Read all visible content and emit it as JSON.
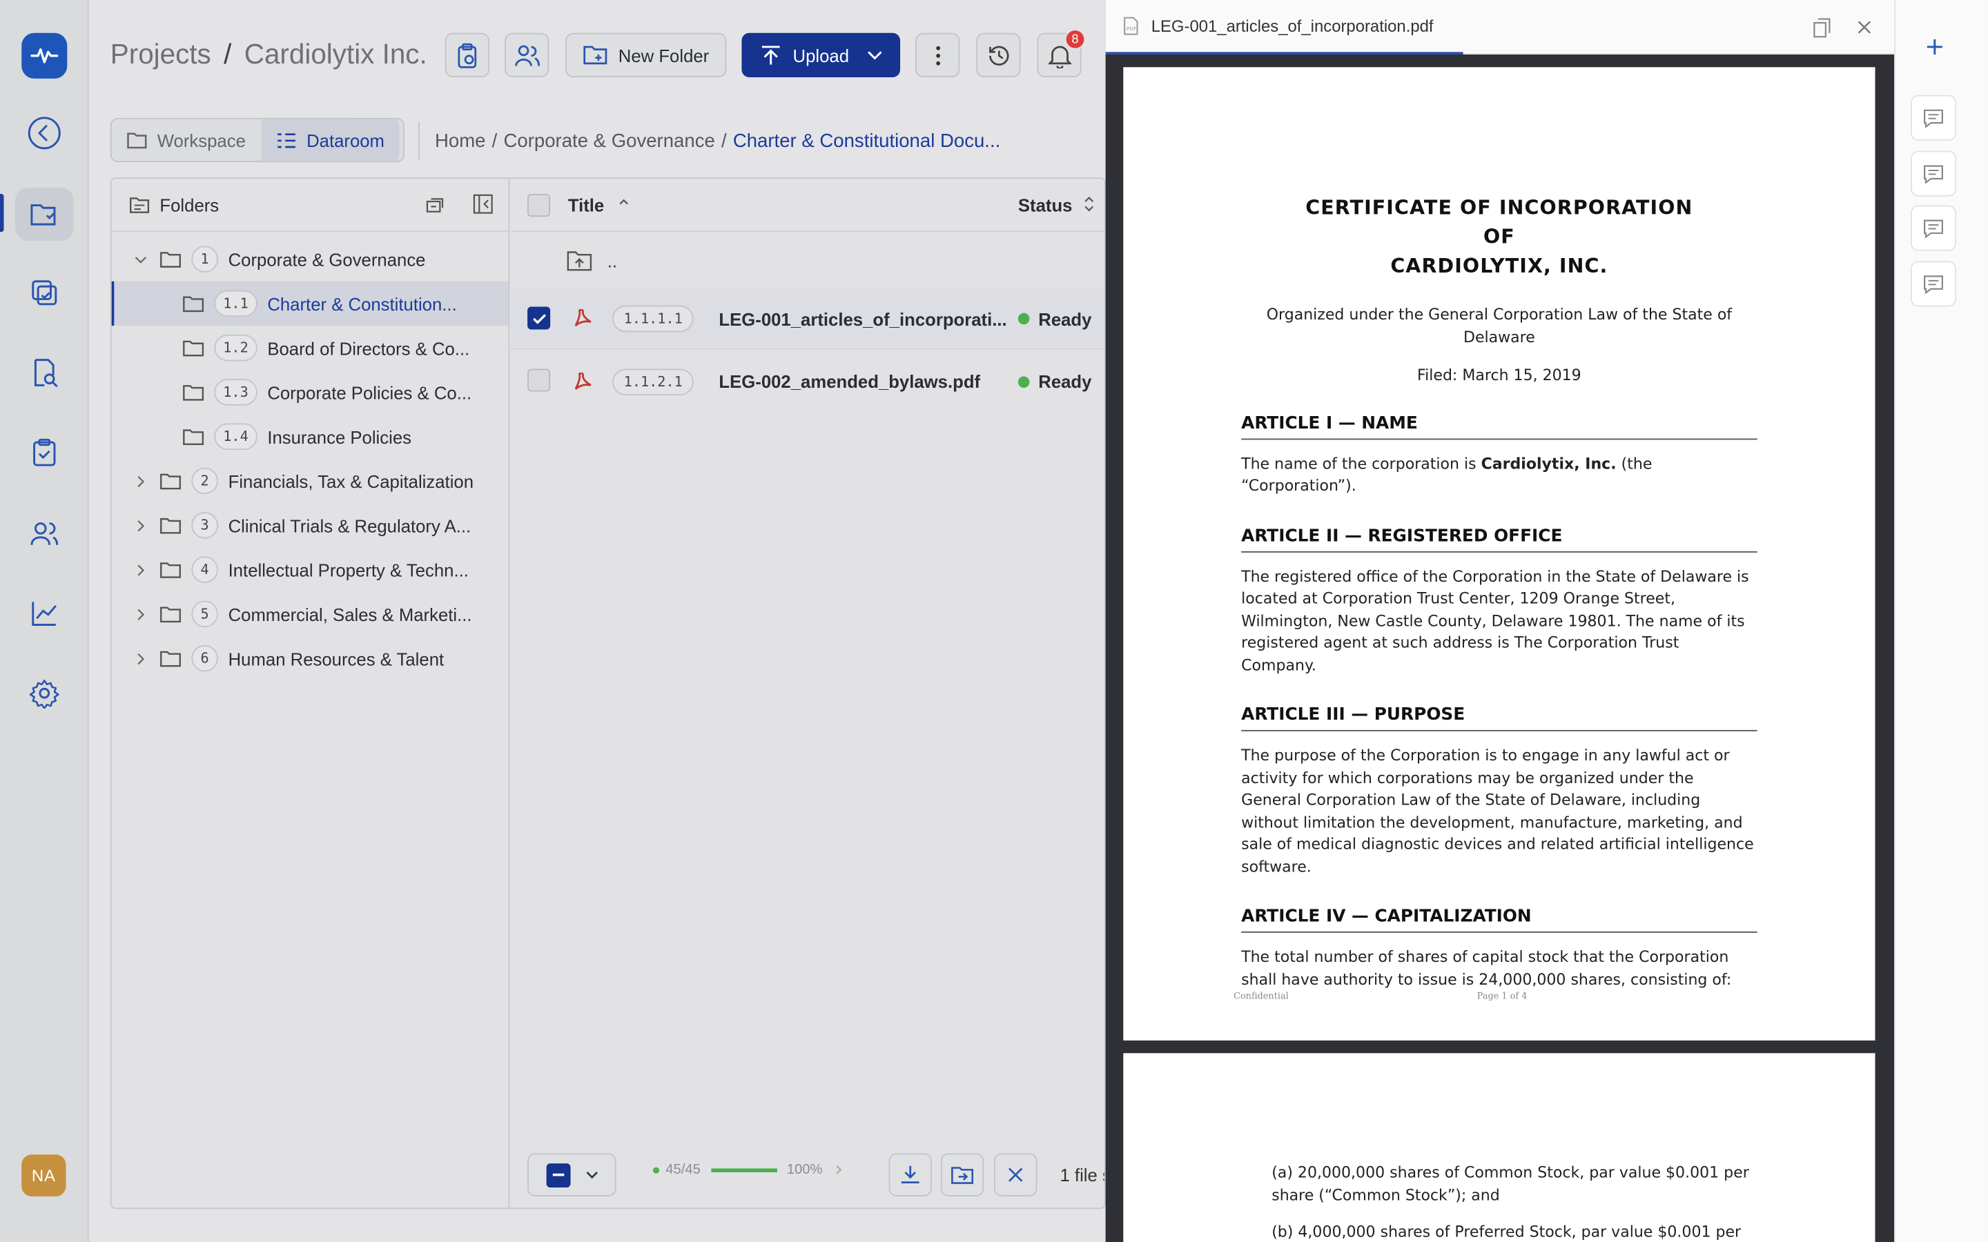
{
  "header": {
    "title": "Projects",
    "project": "Cardiolytix Inc.",
    "new_folder_label": "New Folder",
    "upload_label": "Upload",
    "notification_count": "8"
  },
  "view_toggle": {
    "workspace": "Workspace",
    "dataroom": "Dataroom"
  },
  "breadcrumb": [
    "Home",
    "Corporate & Governance",
    "Charter & Constitutional Docu..."
  ],
  "folders": {
    "title": "Folders",
    "items": [
      {
        "num": "1",
        "label": "Corporate & Governance"
      },
      {
        "num": "1.1",
        "label": "Charter & Constitution..."
      },
      {
        "num": "1.2",
        "label": "Board of Directors & Co..."
      },
      {
        "num": "1.3",
        "label": "Corporate Policies & Co..."
      },
      {
        "num": "1.4",
        "label": "Insurance Policies"
      },
      {
        "num": "2",
        "label": "Financials, Tax & Capitalization"
      },
      {
        "num": "3",
        "label": "Clinical Trials & Regulatory A..."
      },
      {
        "num": "4",
        "label": "Intellectual Property & Techn..."
      },
      {
        "num": "5",
        "label": "Commercial, Sales & Marketi..."
      },
      {
        "num": "6",
        "label": "Human Resources & Talent"
      }
    ]
  },
  "documents": {
    "col_title": "Title",
    "col_status": "Status",
    "parent_label": "..",
    "rows": [
      {
        "code": "1.1.1.1",
        "name": "LEG-001_articles_of_incorporati...",
        "status": "Ready"
      },
      {
        "code": "1.1.2.1",
        "name": "LEG-002_amended_bylaws.pdf",
        "status": "Ready"
      }
    ]
  },
  "footer": {
    "count": "45/45",
    "percent": "100%",
    "progress_fraction": 1.0,
    "selection_text": "1 file s"
  },
  "user": {
    "initials": "NA"
  },
  "viewer": {
    "filename": "LEG-001_articles_of_incorporation.pdf",
    "doc": {
      "title_lines": [
        "CERTIFICATE OF INCORPORATION",
        "OF",
        "CARDIOLYTIX, INC."
      ],
      "organized": "Organized under the General Corporation Law of the State of Delaware",
      "filed": "Filed: March 15, 2019",
      "a1_title": "ARTICLE I — NAME",
      "a1_pre": "The name of the corporation is ",
      "a1_bold": "Cardiolytix, Inc.",
      "a1_post": " (the “Corporation”).",
      "a2_title": "ARTICLE II — REGISTERED OFFICE",
      "a2_text": "The registered office of the Corporation in the State of Delaware is located at Corporation Trust Center, 1209 Orange Street, Wilmington, New Castle County, Delaware 19801. The name of its registered agent at such address is The Corporation Trust Company.",
      "a3_title": "ARTICLE III — PURPOSE",
      "a3_text": "The purpose of the Corporation is to engage in any lawful act or activity for which corporations may be organized under the General Corporation Law of the State of Delaware, including without limitation the development, manufacture, marketing, and sale of medical diagnostic devices and related artificial intelligence software.",
      "a4_title": "ARTICLE IV — CAPITALIZATION",
      "a4_text": "The total number of shares of capital stock that the Corporation shall have authority to issue is 24,000,000 shares, consisting of:",
      "footer_left": "Confidential",
      "footer_center": "Page 1 of 4",
      "p2_a": "(a) 20,000,000 shares of Common Stock, par value $0.001 per share (“Common Stock”); and",
      "p2_b": "(b) 4,000,000 shares of Preferred Stock, par value $0.001 per"
    }
  },
  "colors": {
    "accent": "#15338f",
    "brand": "#1d56b8",
    "ready": "#4caf50",
    "badge": "#e03b3b"
  }
}
